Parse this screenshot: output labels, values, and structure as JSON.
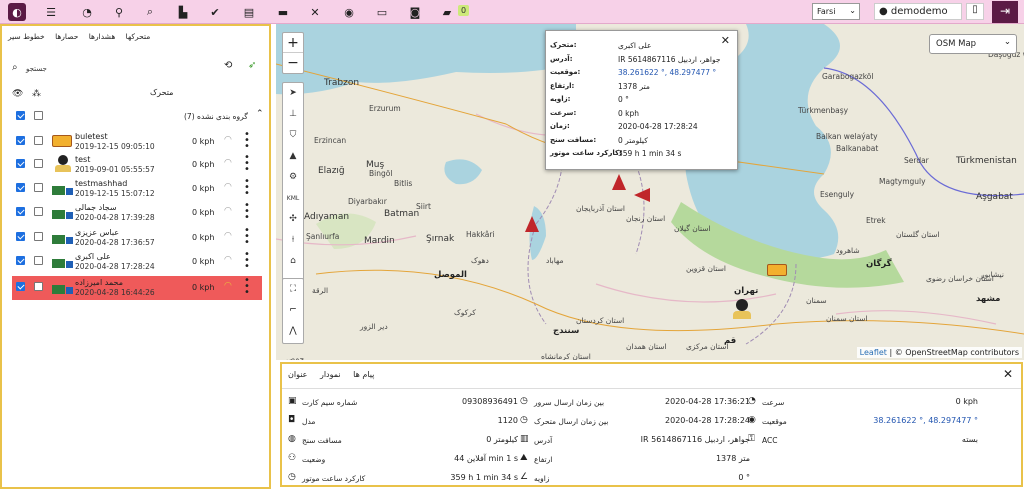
{
  "topbar": {
    "notification_count": "0",
    "language": "Farsi",
    "username": "demodemo",
    "icons": [
      "logo-icon",
      "sliders-icon",
      "speedometer-icon",
      "location-pin-icon",
      "search-icon",
      "chart-icon",
      "check-icon",
      "map-book-icon",
      "vehicle-icon",
      "tools-icon",
      "database-icon",
      "code-icon",
      "camera-icon",
      "chat-icon"
    ]
  },
  "left_panel": {
    "tabs": [
      "خطوط سیر",
      "حصارها",
      "هشدارها",
      "متحرکها"
    ],
    "search_label": "جستجو",
    "list_title": "متحرک",
    "group_label": "(7) گروه بندی نشده",
    "vehicles": [
      {
        "name": "buletest",
        "date": "2019-12-15 09:05:10",
        "speed": "0 kph",
        "icon": "bus-icon",
        "selected": false
      },
      {
        "name": "test",
        "date": "2019-09-01 05:55:57",
        "speed": "0 kph",
        "icon": "person-icon",
        "selected": false
      },
      {
        "name": "testmashhad",
        "date": "2019-12-15 15:07:12",
        "speed": "0 kph",
        "icon": "truck-icon",
        "selected": false
      },
      {
        "name": "سجاد جمالی",
        "date": "2020-04-28 17:39:28",
        "speed": "0 kph",
        "icon": "truck-icon",
        "selected": false
      },
      {
        "name": "عباس عزیزی",
        "date": "2020-04-28 17:36:57",
        "speed": "0 kph",
        "icon": "truck-icon",
        "selected": false
      },
      {
        "name": "علی اکبری",
        "date": "2020-04-28 17:28:24",
        "speed": "0 kph",
        "icon": "truck-icon",
        "selected": false
      },
      {
        "name": "محمد امیرزاده",
        "date": "2020-04-28 16:44:26",
        "speed": "0 kph",
        "icon": "truck-icon",
        "selected": true
      }
    ]
  },
  "map": {
    "layer": "OSM Map",
    "attribution_leaflet": "Leaflet",
    "attribution_rest": "| © OpenStreetMap contributors",
    "labels": [
      {
        "text": "Trabzon",
        "cls": "big"
      },
      {
        "text": "Erzurum",
        "cls": ""
      },
      {
        "text": "Erzincan",
        "cls": ""
      },
      {
        "text": "Elazığ",
        "cls": "big"
      },
      {
        "text": "Muş",
        "cls": "big"
      },
      {
        "text": "Bitlis",
        "cls": ""
      },
      {
        "text": "Bingöl",
        "cls": ""
      },
      {
        "text": "Diyarbakır",
        "cls": ""
      },
      {
        "text": "Batman",
        "cls": "big"
      },
      {
        "text": "Siirt",
        "cls": ""
      },
      {
        "text": "Adıyaman",
        "cls": "big"
      },
      {
        "text": "Şanlıurfa",
        "cls": ""
      },
      {
        "text": "Mardin",
        "cls": "big"
      },
      {
        "text": "Şırnak",
        "cls": "big"
      },
      {
        "text": "Hakkâri",
        "cls": ""
      },
      {
        "text": "Garabogazköl",
        "cls": ""
      },
      {
        "text": "Türkmenbaşy",
        "cls": ""
      },
      {
        "text": "Balkan welaýaty",
        "cls": ""
      },
      {
        "text": "Balkanabat",
        "cls": ""
      },
      {
        "text": "Serdar",
        "cls": ""
      },
      {
        "text": "Türkmenistan",
        "cls": "big"
      },
      {
        "text": "Magtymguly",
        "cls": ""
      },
      {
        "text": "Aşgabat",
        "cls": "big"
      },
      {
        "text": "Esenguly",
        "cls": ""
      },
      {
        "text": "Etrek",
        "cls": ""
      },
      {
        "text": "Daşoguz welaýaty",
        "cls": ""
      },
      {
        "text": "استان آذربایجان",
        "cls": ""
      },
      {
        "text": "استان زنجان",
        "cls": ""
      },
      {
        "text": "استان گیلان",
        "cls": ""
      },
      {
        "text": "گرگان",
        "cls": "city"
      },
      {
        "text": "تهران",
        "cls": "city"
      },
      {
        "text": "استان قزوین",
        "cls": ""
      },
      {
        "text": "الموصل",
        "cls": "city"
      },
      {
        "text": "دهوک",
        "cls": ""
      },
      {
        "text": "مهاباد",
        "cls": ""
      },
      {
        "text": "سنندج",
        "cls": "city"
      },
      {
        "text": "استان کردستان",
        "cls": ""
      },
      {
        "text": "استان همدان",
        "cls": ""
      },
      {
        "text": "استان مرکزی",
        "cls": ""
      },
      {
        "text": "قم",
        "cls": "city"
      },
      {
        "text": "سمنان",
        "cls": ""
      },
      {
        "text": "استان سمنان",
        "cls": ""
      },
      {
        "text": "استان کرمانشاه",
        "cls": ""
      },
      {
        "text": "نیشابور",
        "cls": ""
      },
      {
        "text": "مشهد",
        "cls": "city"
      },
      {
        "text": "شاهرود",
        "cls": ""
      },
      {
        "text": "کرکوک",
        "cls": ""
      },
      {
        "text": "الرقة",
        "cls": ""
      },
      {
        "text": "دیر الزور",
        "cls": ""
      },
      {
        "text": "حمص",
        "cls": ""
      },
      {
        "text": "استان خراسان رضوی",
        "cls": ""
      },
      {
        "text": "استان گلستان",
        "cls": ""
      }
    ]
  },
  "popup": {
    "rows": [
      {
        "k": "متحرک:",
        "v": "علی اکبری",
        "blue": false
      },
      {
        "k": "آدرس:",
        "v": "IR جواهر، اردبیل 5614867116",
        "blue": false
      },
      {
        "k": "موقعیت:",
        "v": "38.261622 °, 48.297477 °",
        "blue": true
      },
      {
        "k": "ارتفاع:",
        "v": "1378 متر",
        "blue": false
      },
      {
        "k": "زاویه:",
        "v": "0 °",
        "blue": false
      },
      {
        "k": "سرعت:",
        "v": "0 kph",
        "blue": false
      },
      {
        "k": "زمان:",
        "v": "2020-04-28 17:28:24",
        "blue": false
      },
      {
        "k": "مسافت سنج:",
        "v": "0 کیلومتر",
        "blue": false
      },
      {
        "k": "کارکرد ساعت موتور:",
        "v": "359 h 1 min 34 s",
        "blue": false
      }
    ]
  },
  "bottom": {
    "tabs": [
      "پیام ها",
      "نمودار",
      "عنوان"
    ],
    "col1": [
      {
        "icon": "sim-icon",
        "k": "شماره سیم کارت",
        "v": "09308936491"
      },
      {
        "icon": "car-icon",
        "k": "مدل",
        "v": "1120"
      },
      {
        "icon": "odometer-icon",
        "k": "مسافت سنج",
        "v": "0 کیلومتر"
      },
      {
        "icon": "status-icon",
        "k": "وضعیت",
        "v": "44 آفلاین min 1 s"
      },
      {
        "icon": "clock-icon",
        "k": "کارکرد ساعت موتور",
        "v": "359 h 1 min 34 s"
      }
    ],
    "col2": [
      {
        "icon": "clock-icon",
        "k": "بین زمان ارسال سرور",
        "v": "2020-04-28 17:36:21"
      },
      {
        "icon": "clock-icon",
        "k": "بین زمان ارسال متحرک",
        "v": "2020-04-28 17:28:24"
      },
      {
        "icon": "address-icon",
        "k": "آدرس",
        "v": "IR جواهر، اردبیل 5614867116"
      },
      {
        "icon": "altitude-icon",
        "k": "ارتفاع",
        "v": "1378 متر"
      },
      {
        "icon": "angle-icon",
        "k": "زاویه",
        "v": "0 °"
      }
    ],
    "col3": [
      {
        "icon": "speed-icon",
        "k": "سرعت",
        "v": "0 kph",
        "blue": false
      },
      {
        "icon": "location-icon",
        "k": "موقعیت",
        "v": "38.261622 °, 48.297477 °",
        "blue": true
      },
      {
        "icon": "acc-icon",
        "k": "ACC",
        "v": "بسته",
        "blue": false
      }
    ]
  }
}
